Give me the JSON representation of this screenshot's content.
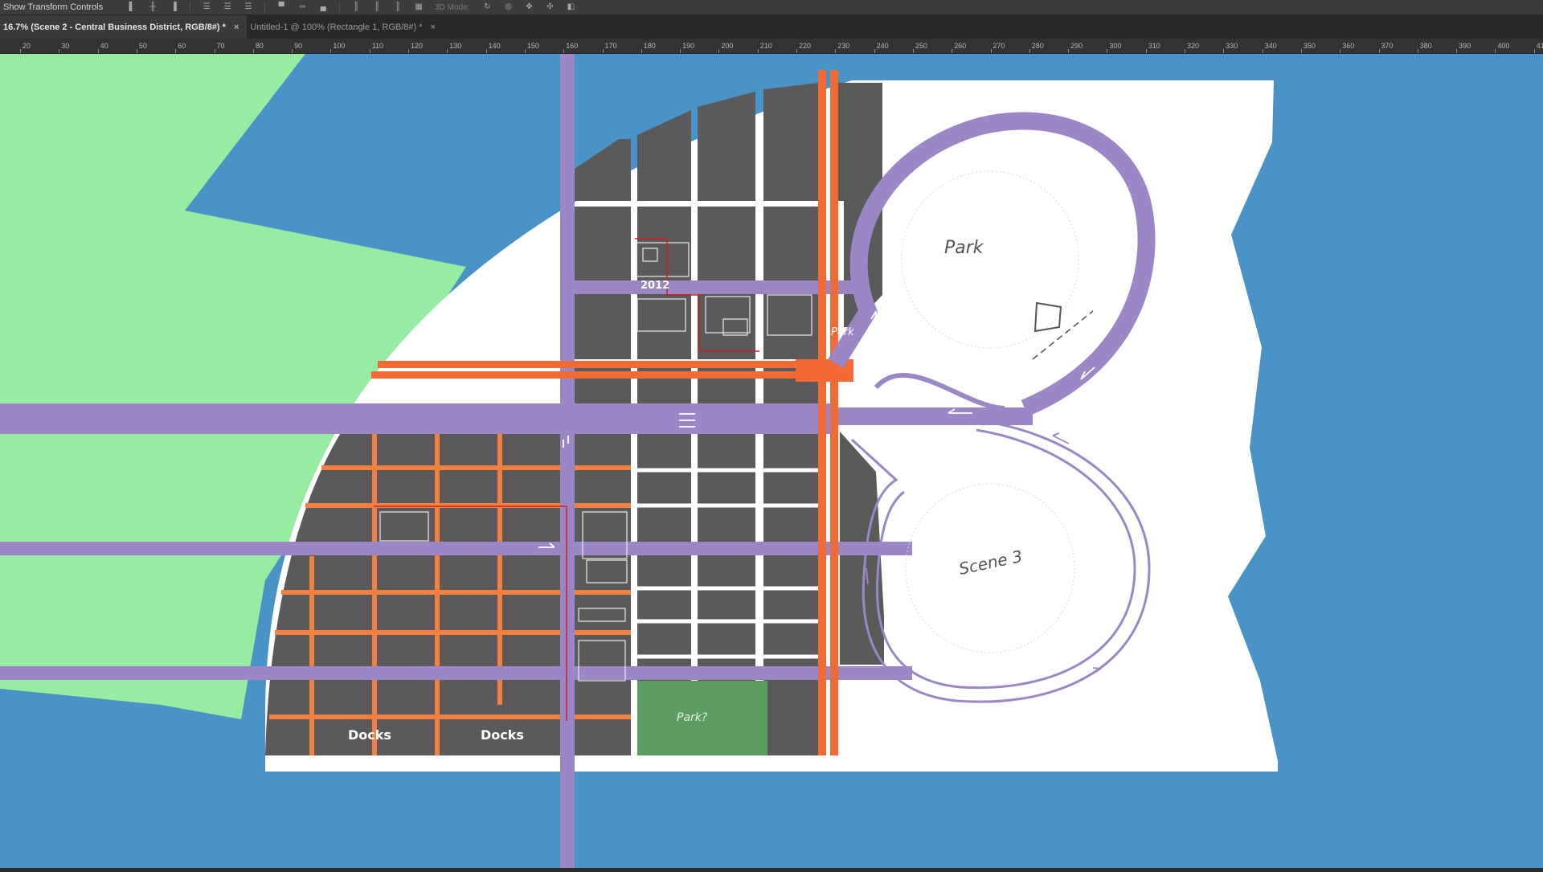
{
  "options_bar": {
    "show_transform_label": "Show Transform Controls",
    "mode_label": "3D Mode:",
    "icons": [
      "align-left-edges-icon",
      "align-horizontal-centers-icon",
      "align-right-edges-icon",
      "distribute-left-icon",
      "distribute-centers-icon",
      "distribute-right-icon",
      "align-top-icon",
      "align-middle-icon",
      "align-bottom-icon",
      "distribute-top-icon",
      "distribute-middle-icon",
      "distribute-bottom-icon",
      "auto-align-icon"
    ],
    "mode_icons": [
      "3d-rotate-icon",
      "3d-roll-icon",
      "3d-pan-icon",
      "3d-slide-icon",
      "3d-scale-icon"
    ]
  },
  "tabs": [
    {
      "label": "16.7% (Scene 2 - Central Business District, RGB/8#) *",
      "active": true
    },
    {
      "label": "Untitled-1 @ 100% (Rectangle 1, RGB/8#) *",
      "active": false
    }
  ],
  "ruler": {
    "ticks": [
      "20",
      "30",
      "40",
      "50",
      "60",
      "70",
      "80",
      "90",
      "100",
      "110",
      "120",
      "130",
      "140",
      "150",
      "160",
      "170",
      "180",
      "190",
      "200",
      "210",
      "220",
      "230",
      "240",
      "250",
      "260",
      "270",
      "280",
      "290",
      "300",
      "310",
      "320",
      "330",
      "340",
      "350",
      "360",
      "370",
      "380",
      "390",
      "400",
      "41"
    ]
  },
  "map": {
    "labels": {
      "docks_1": "Docks",
      "docks_2": "Docks",
      "park_small": "Park?",
      "park_big": "Park",
      "park_road": "Park",
      "scene3": "Scene 3",
      "year": "2012"
    },
    "colors": {
      "water": "#4a93c6",
      "land": "#97eba2",
      "island": "#ffffff",
      "block": "#5a5a5a",
      "road_purple": "#9b86c6",
      "road_orange": "#f26a36",
      "park_green": "#5c9e62"
    }
  }
}
